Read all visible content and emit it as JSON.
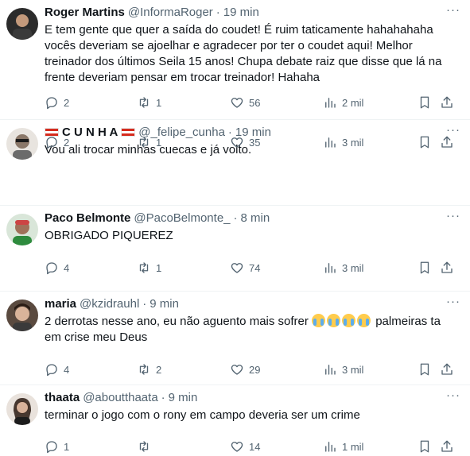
{
  "tweets": [
    {
      "name": "Roger Martins",
      "handle": "@InformaRoger",
      "dot": "·",
      "time": "19 min",
      "text": "E tem gente que quer a saída do coudet! É ruim taticamente hahahahaha vocês deveriam se ajoelhar e agradecer por ter o coudet aqui! Melhor treinador dos últimos Seila 15 anos! Chupa debate raiz que disse que lá na frente deveriam pensar em trocar treinador! Hahaha",
      "replies": "2",
      "retweets": "1",
      "likes": "56",
      "views": "2 mil"
    },
    {
      "name_prefix_flag": true,
      "name": "C U N H A",
      "handle": "@_felipe_cunha",
      "dot": "·",
      "time": "19 min",
      "text": "Vou ali trocar minhas cuecas e já volto.",
      "replies": "2",
      "retweets": "1",
      "likes": "35",
      "views": "3 mil"
    },
    {
      "name": "Paco Belmonte",
      "handle": "@PacoBelmonte_",
      "dot": "·",
      "time": "8 min",
      "text": "OBRIGADO PIQUEREZ",
      "replies": "4",
      "retweets": "1",
      "likes": "74",
      "views": "3 mil"
    },
    {
      "name": "maria",
      "handle": "@kzidrauhl",
      "dot": "·",
      "time": "9 min",
      "text_before": "2 derrotas nesse ano, eu não aguento mais sofrer ",
      "emoji": "loudly-crying-face x4",
      "text_after": " palmeiras ta em crise meu Deus",
      "replies": "4",
      "retweets": "2",
      "likes": "29",
      "views": "3 mil"
    },
    {
      "name": "thaata",
      "handle": "@aboutthaata",
      "dot": "·",
      "time": "9 min",
      "text": "terminar o jogo com o rony em campo deveria ser um crime",
      "replies": "1",
      "retweets": "",
      "likes": "14",
      "views": "1 mil"
    }
  ],
  "more_label": "···",
  "icons": {
    "reply": "reply-icon",
    "retweet": "retweet-icon",
    "like": "heart-icon",
    "views": "views-icon",
    "bookmark": "bookmark-icon",
    "share": "share-icon"
  },
  "colors": {
    "text": "#0f1419",
    "secondary": "#536471",
    "divider": "#eff3f4"
  }
}
